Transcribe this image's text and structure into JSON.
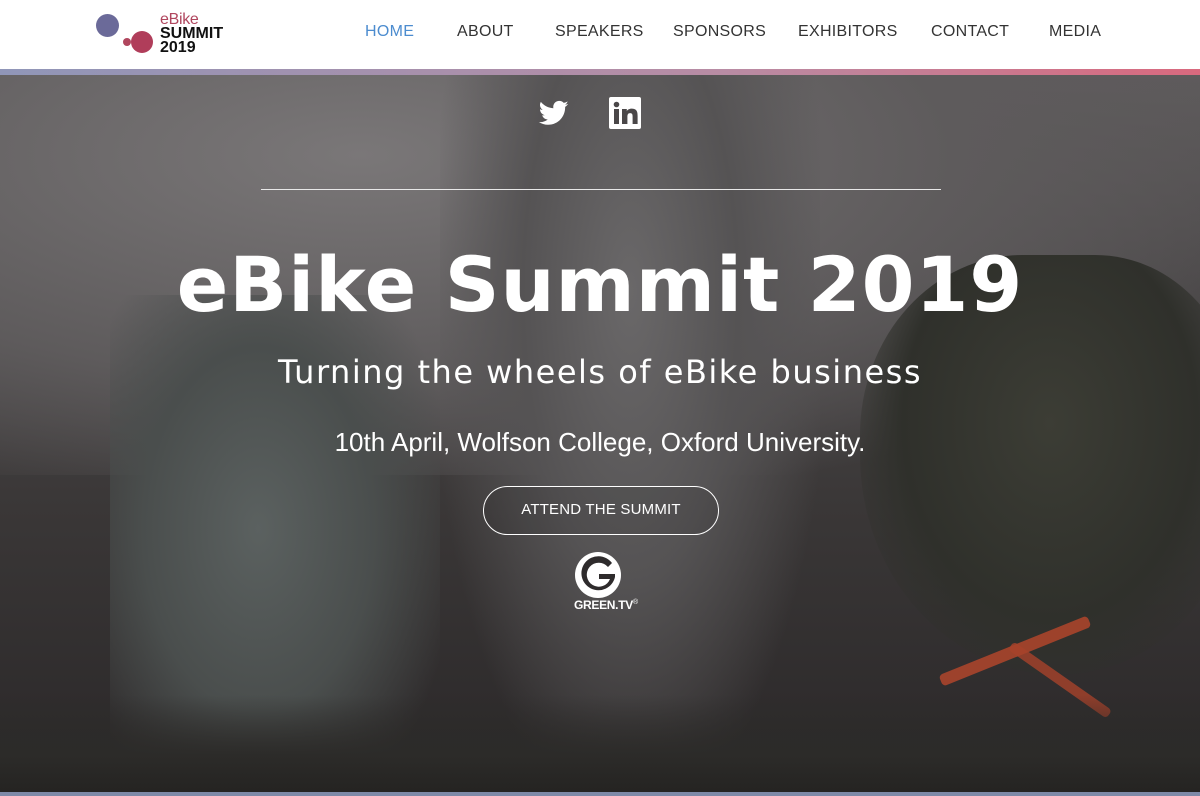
{
  "logo": {
    "line1": "eBike",
    "line2": "SUMMIT",
    "line3": "2019",
    "colors": {
      "accent": "#b0465e",
      "dot_blue": "#6b6a99",
      "dot_red": "#b03d5a"
    }
  },
  "nav": {
    "items": [
      {
        "label": "HOME",
        "active": true
      },
      {
        "label": "ABOUT",
        "active": false
      },
      {
        "label": "SPEAKERS",
        "active": false
      },
      {
        "label": "SPONSORS",
        "active": false
      },
      {
        "label": "EXHIBITORS",
        "active": false
      },
      {
        "label": "CONTACT",
        "active": false
      },
      {
        "label": "MEDIA",
        "active": false
      }
    ],
    "active_color": "#4c8ccf"
  },
  "social": {
    "icons": [
      "twitter-icon",
      "linkedin-icon"
    ]
  },
  "hero": {
    "title": "eBike Summit 2019",
    "subtitle": "Turning the wheels of eBike business",
    "date_location": "10th April, Wolfson College, Oxford University.",
    "cta_label": "ATTEND THE SUMMIT",
    "partner_logo_text": "GREEN.TV",
    "partner_logo_mark": "®"
  }
}
